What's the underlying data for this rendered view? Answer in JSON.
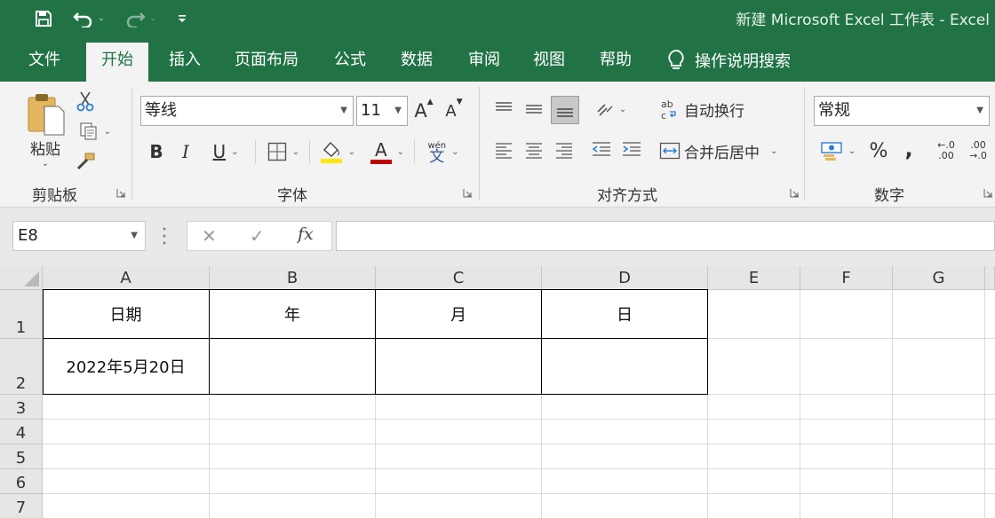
{
  "title_bar": {
    "title": "新建 Microsoft Excel 工作表  -  Excel",
    "accent_color": "#217346"
  },
  "quick_access": [
    {
      "icon": "save-icon"
    },
    {
      "icon": "undo-icon"
    },
    {
      "icon": "redo-icon"
    },
    {
      "icon": "customize-qat-icon"
    }
  ],
  "tabs": [
    {
      "label": "文件",
      "active": false
    },
    {
      "label": "开始",
      "active": true
    },
    {
      "label": "插入",
      "active": false
    },
    {
      "label": "页面布局",
      "active": false
    },
    {
      "label": "公式",
      "active": false
    },
    {
      "label": "数据",
      "active": false
    },
    {
      "label": "审阅",
      "active": false
    },
    {
      "label": "视图",
      "active": false
    },
    {
      "label": "帮助",
      "active": false
    }
  ],
  "tell_me": {
    "label": "操作说明搜索",
    "icon": "lightbulb-icon"
  },
  "ribbon": {
    "clipboard": {
      "label": "剪贴板",
      "paste_label": "粘贴"
    },
    "font": {
      "label": "字体",
      "font_name": "等线",
      "font_size": "11",
      "bold": "B",
      "italic": "I",
      "underline": "U",
      "grow_font": "A",
      "shrink_font": "A",
      "font_color_glyph": "A",
      "phonetic_top": "wén",
      "phonetic_char": "文"
    },
    "alignment": {
      "label": "对齐方式",
      "wrap_text": "自动换行",
      "merge_center": "合并后居中"
    },
    "number": {
      "label": "数字",
      "format": "常规",
      "percent": "%",
      "comma": ",",
      "inc_top": "←.0",
      "inc_bot": ".00",
      "dec_top": ".00",
      "dec_bot": "→.0"
    }
  },
  "formula_bar": {
    "name_box": "E8",
    "cancel_glyph": "✕",
    "enter_glyph": "✓",
    "fx_glyph": "fx",
    "formula": ""
  },
  "sheet": {
    "columns": [
      "A",
      "B",
      "C",
      "D",
      "E",
      "F",
      "G"
    ],
    "rows": [
      "1",
      "2",
      "3",
      "4",
      "5",
      "6",
      "7"
    ],
    "cells": {
      "A1": "日期",
      "B1": "年",
      "C1": "月",
      "D1": "日",
      "A2": "2022年5月20日",
      "B2": "",
      "C2": "",
      "D2": ""
    }
  }
}
